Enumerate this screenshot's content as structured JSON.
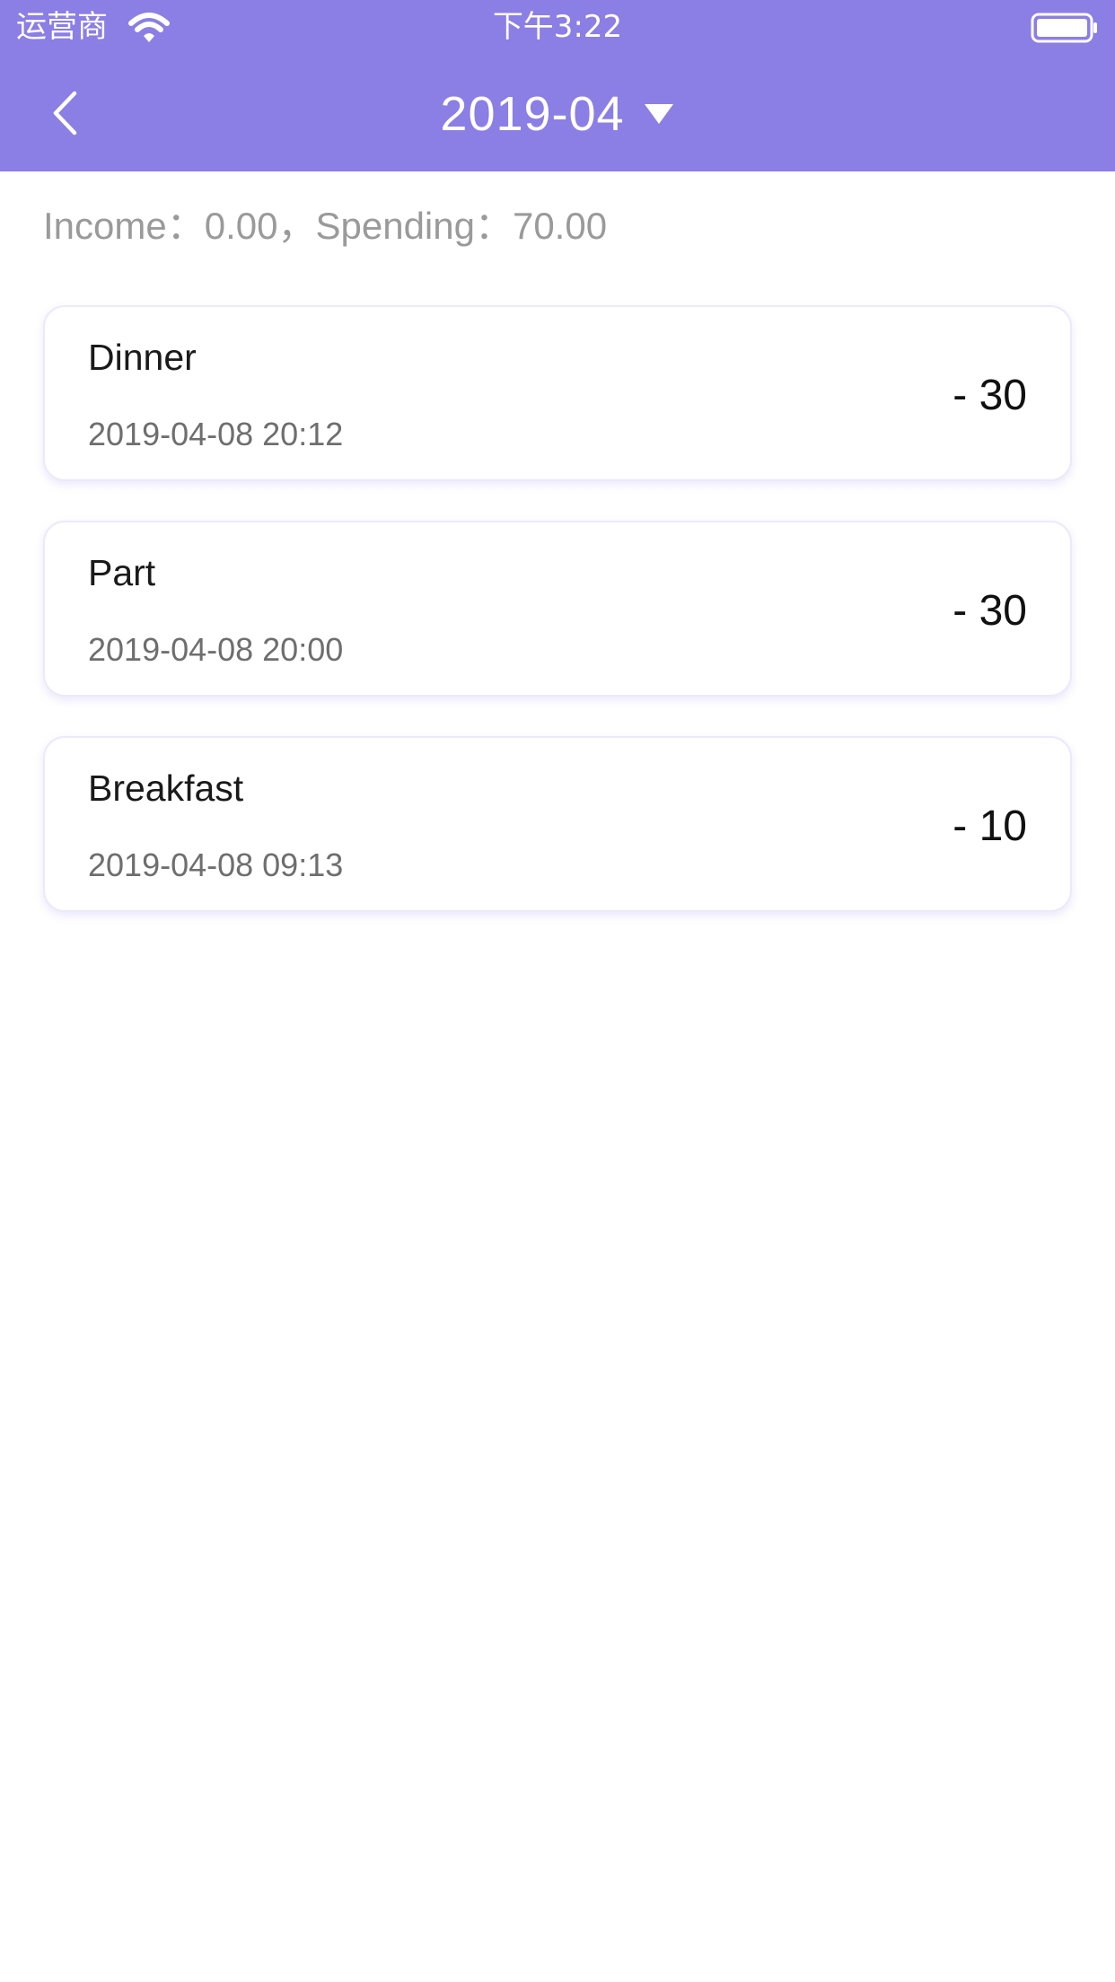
{
  "status_bar": {
    "carrier": "运营商",
    "time": "下午3:22"
  },
  "nav": {
    "month": "2019-04"
  },
  "summary": {
    "text": "Income：0.00，Spending：70.00"
  },
  "records": [
    {
      "title": "Dinner",
      "time": "2019-04-08 20:12",
      "amount": "- 30"
    },
    {
      "title": "Part",
      "time": "2019-04-08 20:00",
      "amount": "- 30"
    },
    {
      "title": "Breakfast",
      "time": "2019-04-08 09:13",
      "amount": "- 10"
    }
  ],
  "colors": {
    "accent": "#8b7ee5",
    "text_primary": "#1a1a1a",
    "text_secondary": "#6e6e6e",
    "summary_text": "#9a9a9a"
  },
  "icons": {
    "status": [
      "wifi-icon",
      "battery-icon"
    ],
    "nav": [
      "back-chevron-icon",
      "dropdown-triangle-icon"
    ]
  }
}
